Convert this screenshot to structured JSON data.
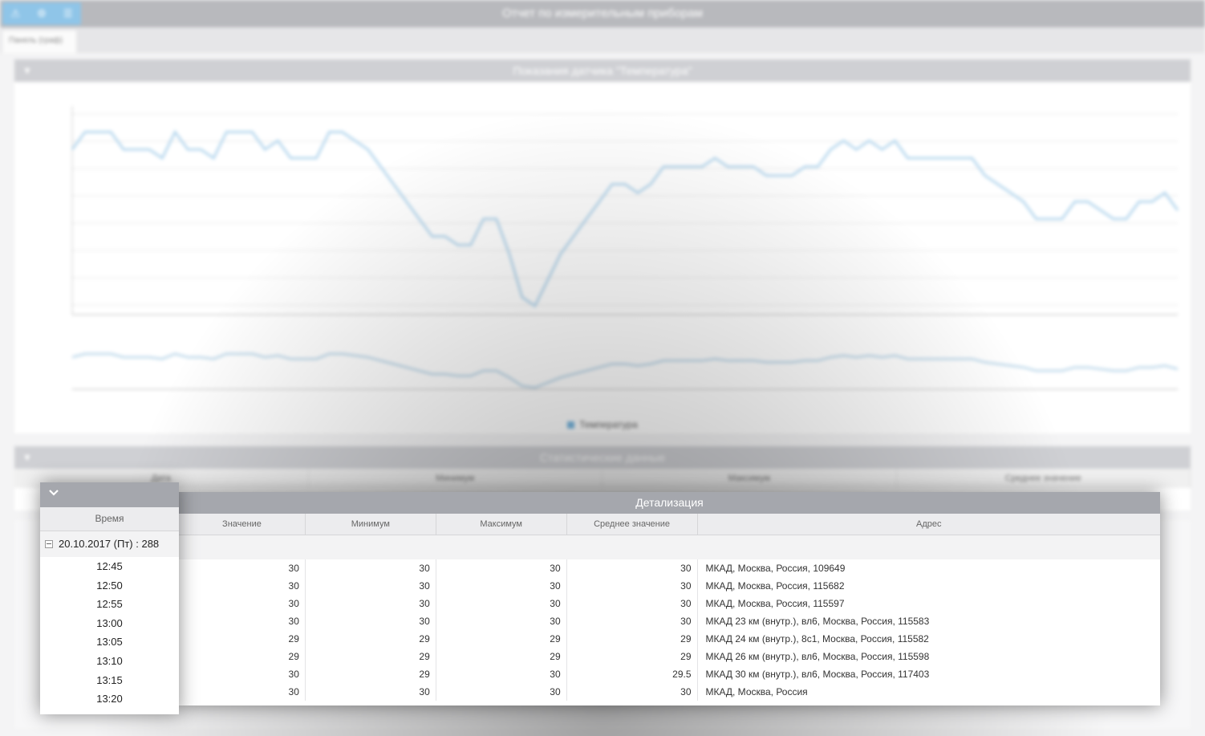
{
  "app": {
    "window_title": "Отчет по измерительным приборам",
    "toolbar_icons": [
      "alert-icon",
      "gear-icon",
      "layers-icon"
    ],
    "tab_label": "Панель (граф)"
  },
  "chart_panel": {
    "title": "Показания датчика \"Температура\"",
    "legend": "Температура",
    "chart_data": {
      "type": "line",
      "series": [
        {
          "name": "Температура",
          "values": [
            29,
            30,
            30,
            30,
            29,
            29,
            29,
            28.5,
            30,
            29,
            29,
            28.5,
            30,
            30,
            30,
            29,
            29.5,
            28.5,
            28.5,
            28.5,
            30,
            30,
            29.5,
            29,
            28,
            27,
            26,
            25,
            24,
            24,
            23.5,
            23.5,
            25,
            25,
            23,
            20.5,
            20,
            21.5,
            23,
            24,
            25,
            26,
            27,
            27,
            26.5,
            27,
            28,
            28,
            28,
            28,
            28.5,
            28,
            28,
            28,
            27.5,
            27.5,
            27.5,
            28,
            28,
            29,
            29.5,
            29,
            29.5,
            29,
            29.5,
            28.5,
            28.5,
            28.5,
            28.5,
            28.5,
            28.5,
            27.5,
            27,
            26.5,
            26,
            25,
            25,
            25,
            26,
            26,
            25.5,
            25,
            25,
            26,
            26,
            26.5,
            25.5
          ]
        }
      ]
    }
  },
  "stats_panel": {
    "title": "Статистические данные",
    "columns": [
      "Дата",
      "Минимум",
      "Максимум",
      "Среднее значение"
    ]
  },
  "detail_panel": {
    "title": "Детализация",
    "columns": [
      "Значение",
      "Минимум",
      "Максимум",
      "Среднее значение",
      "Адрес"
    ],
    "rows": [
      [
        "30",
        "30",
        "30",
        "30",
        "МКАД, Москва, Россия, 109649"
      ],
      [
        "30",
        "30",
        "30",
        "30",
        "МКАД, Москва, Россия, 115682"
      ],
      [
        "30",
        "30",
        "30",
        "30",
        "МКАД, Москва, Россия, 115597"
      ],
      [
        "30",
        "30",
        "30",
        "30",
        "МКАД 23 км (внутр.), вл6, Москва, Россия, 115583"
      ],
      [
        "29",
        "29",
        "29",
        "29",
        "МКАД 24 км (внутр.), 8с1, Москва, Россия, 115582"
      ],
      [
        "29",
        "29",
        "29",
        "29",
        "МКАД 26 км (внутр.), вл6, Москва, Россия, 115598"
      ],
      [
        "30",
        "29",
        "30",
        "29.5",
        "МКАД 30 км (внутр.), вл6, Москва, Россия, 117403"
      ],
      [
        "30",
        "30",
        "30",
        "30",
        "МКАД, Москва, Россия"
      ]
    ]
  },
  "time_panel": {
    "column": "Время",
    "group": "20.10.2017 (Пт) : 288",
    "times": [
      "12:45",
      "12:50",
      "12:55",
      "13:00",
      "13:05",
      "13:10",
      "13:15",
      "13:20"
    ]
  }
}
